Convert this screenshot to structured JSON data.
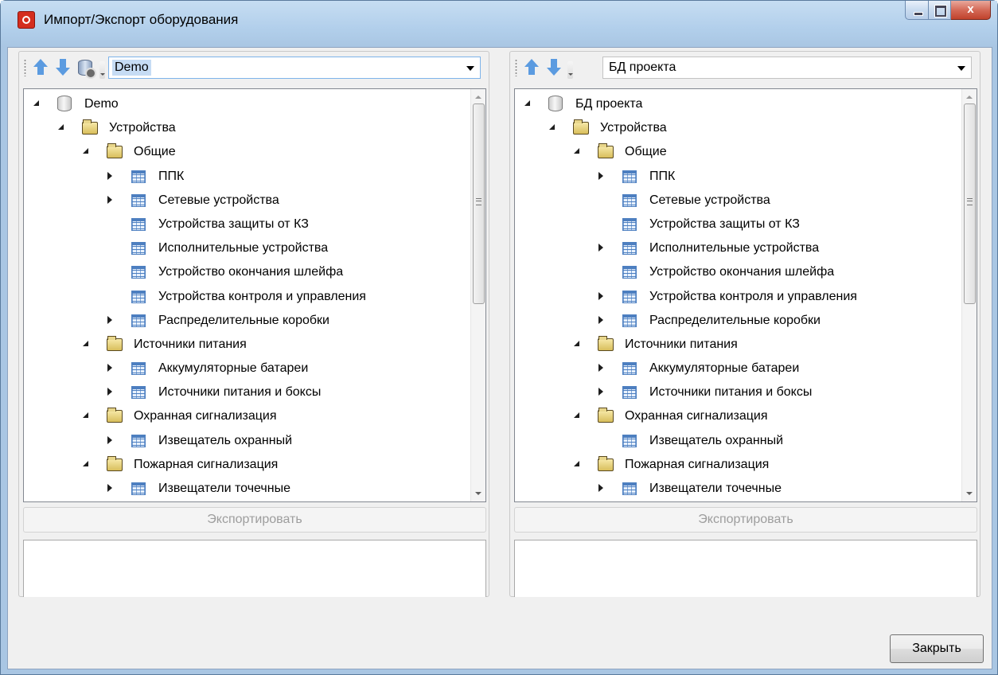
{
  "window": {
    "title": "Импорт/Экспорт оборудования",
    "close_glyph": "x"
  },
  "left_panel": {
    "selected_db": "Demo",
    "export_label": "Экспортировать",
    "tree": [
      {
        "label": "Demo",
        "level": 0,
        "icon": "database-icon",
        "expander": "open"
      },
      {
        "label": "Устройства",
        "level": 1,
        "icon": "folder-icon",
        "expander": "open"
      },
      {
        "label": "Общие",
        "level": 2,
        "icon": "folder-icon",
        "expander": "open"
      },
      {
        "label": "ППК",
        "level": 3,
        "icon": "table-icon",
        "expander": "closed"
      },
      {
        "label": "Сетевые устройства",
        "level": 3,
        "icon": "table-icon",
        "expander": "closed"
      },
      {
        "label": "Устройства защиты от КЗ",
        "level": 3,
        "icon": "table-icon",
        "expander": "none"
      },
      {
        "label": "Исполнительные устройства",
        "level": 3,
        "icon": "table-icon",
        "expander": "none"
      },
      {
        "label": "Устройство окончания шлейфа",
        "level": 3,
        "icon": "table-icon",
        "expander": "none"
      },
      {
        "label": "Устройства контроля и управления",
        "level": 3,
        "icon": "table-icon",
        "expander": "none"
      },
      {
        "label": "Распределительные коробки",
        "level": 3,
        "icon": "table-icon",
        "expander": "closed"
      },
      {
        "label": "Источники питания",
        "level": 2,
        "icon": "folder-icon",
        "expander": "open"
      },
      {
        "label": "Аккумуляторные батареи",
        "level": 3,
        "icon": "table-icon",
        "expander": "closed"
      },
      {
        "label": "Источники питания и боксы",
        "level": 3,
        "icon": "table-icon",
        "expander": "closed"
      },
      {
        "label": "Охранная сигнализация",
        "level": 2,
        "icon": "folder-icon",
        "expander": "open"
      },
      {
        "label": "Извещатель охранный",
        "level": 3,
        "icon": "table-icon",
        "expander": "closed"
      },
      {
        "label": "Пожарная сигнализация",
        "level": 2,
        "icon": "folder-icon",
        "expander": "open"
      },
      {
        "label": "Извещатели точечные",
        "level": 3,
        "icon": "table-icon",
        "expander": "closed"
      }
    ]
  },
  "right_panel": {
    "selected_db": "БД проекта",
    "export_label": "Экспортировать",
    "tree": [
      {
        "label": "БД проекта",
        "level": 0,
        "icon": "database-icon",
        "expander": "open"
      },
      {
        "label": "Устройства",
        "level": 1,
        "icon": "folder-icon",
        "expander": "open"
      },
      {
        "label": "Общие",
        "level": 2,
        "icon": "folder-icon",
        "expander": "open"
      },
      {
        "label": "ППК",
        "level": 3,
        "icon": "table-icon",
        "expander": "closed"
      },
      {
        "label": "Сетевые устройства",
        "level": 3,
        "icon": "table-icon",
        "expander": "none"
      },
      {
        "label": "Устройства защиты от КЗ",
        "level": 3,
        "icon": "table-icon",
        "expander": "none"
      },
      {
        "label": "Исполнительные устройства",
        "level": 3,
        "icon": "table-icon",
        "expander": "closed"
      },
      {
        "label": "Устройство окончания шлейфа",
        "level": 3,
        "icon": "table-icon",
        "expander": "none"
      },
      {
        "label": "Устройства контроля и управления",
        "level": 3,
        "icon": "table-icon",
        "expander": "closed"
      },
      {
        "label": "Распределительные коробки",
        "level": 3,
        "icon": "table-icon",
        "expander": "closed"
      },
      {
        "label": "Источники питания",
        "level": 2,
        "icon": "folder-icon",
        "expander": "open"
      },
      {
        "label": "Аккумуляторные батареи",
        "level": 3,
        "icon": "table-icon",
        "expander": "closed"
      },
      {
        "label": "Источники питания и боксы",
        "level": 3,
        "icon": "table-icon",
        "expander": "closed"
      },
      {
        "label": "Охранная сигнализация",
        "level": 2,
        "icon": "folder-icon",
        "expander": "open"
      },
      {
        "label": "Извещатель охранный",
        "level": 3,
        "icon": "table-icon",
        "expander": "none"
      },
      {
        "label": "Пожарная сигнализация",
        "level": 2,
        "icon": "folder-icon",
        "expander": "open"
      },
      {
        "label": "Извещатели точечные",
        "level": 3,
        "icon": "table-icon",
        "expander": "closed"
      }
    ]
  },
  "footer": {
    "close_label": "Закрыть"
  }
}
